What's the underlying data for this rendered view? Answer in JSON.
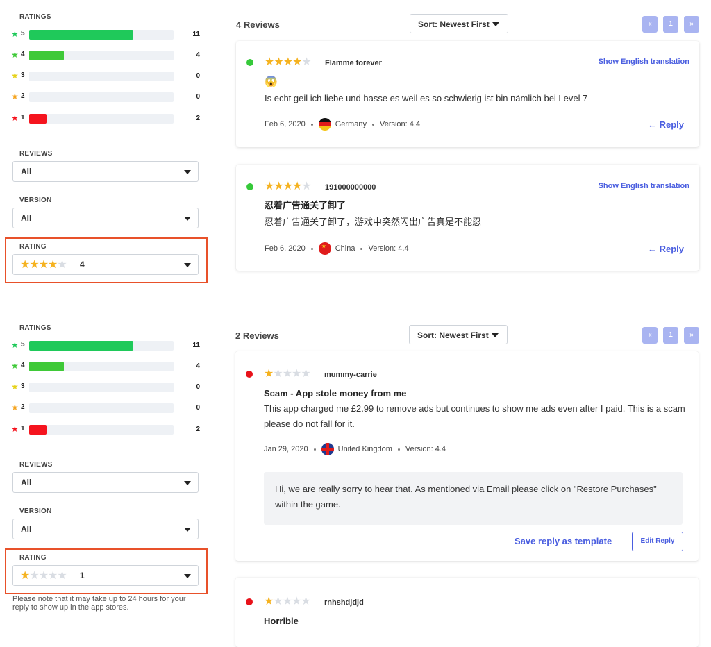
{
  "colors": {
    "accent": "#4a5ee0",
    "star_gold": "#f5b21f",
    "bar_green": "#1fc95a",
    "bar_lightgreen": "#3fc938",
    "bar_red": "#f5141e",
    "highlight": "#e8512a",
    "dot_green": "#36c93a",
    "dot_red": "#e8121a"
  },
  "panels": [
    {
      "sidebar": {
        "ratings_title": "RATINGS",
        "ratings": [
          {
            "stars": "5",
            "count": "11",
            "fraction": 0.72
          },
          {
            "stars": "4",
            "count": "4",
            "fraction": 0.24
          },
          {
            "stars": "3",
            "count": "0",
            "fraction": 0
          },
          {
            "stars": "2",
            "count": "0",
            "fraction": 0
          },
          {
            "stars": "1",
            "count": "2",
            "fraction": 0.12
          }
        ],
        "reviews_title": "REVIEWS",
        "reviews_value": "All",
        "version_title": "VERSION",
        "version_value": "All",
        "rating_title": "RATING",
        "rating_stars": "★★★★",
        "rating_stars_empty": "★",
        "rating_value": "4"
      },
      "header": {
        "count": "4 Reviews",
        "sort_label": "Sort: Newest First",
        "pagination": [
          "«",
          "1",
          "»"
        ]
      },
      "reviews": [
        {
          "stars": "★★★★",
          "stars_empty": "★",
          "author": "Flamme forever",
          "translate": "Show English translation",
          "title": "😱",
          "body": "Is echt geil ich liebe und hasse es weil es so schwierig ist bin nämlich bei Level 7",
          "date": "Feb 6, 2020",
          "country": "Germany",
          "version": "Version: 4.4",
          "reply": "← Reply"
        },
        {
          "stars": "★★★★",
          "stars_empty": "★",
          "author": "191000000000",
          "translate": "Show English translation",
          "title": "忍着广告通关了卸了",
          "body": "忍着广告通关了卸了，游戏中突然闪出广告真是不能忍",
          "date": "Feb 6, 2020",
          "country": "China",
          "version": "Version: 4.4",
          "reply": "← Reply"
        }
      ]
    },
    {
      "sidebar": {
        "ratings_title": "RATINGS",
        "ratings": [
          {
            "stars": "5",
            "count": "11",
            "fraction": 0.72
          },
          {
            "stars": "4",
            "count": "4",
            "fraction": 0.24
          },
          {
            "stars": "3",
            "count": "0",
            "fraction": 0
          },
          {
            "stars": "2",
            "count": "0",
            "fraction": 0
          },
          {
            "stars": "1",
            "count": "2",
            "fraction": 0.12
          }
        ],
        "reviews_title": "REVIEWS",
        "reviews_value": "All",
        "version_title": "VERSION",
        "version_value": "All",
        "rating_title": "RATING",
        "rating_stars": "★",
        "rating_stars_empty": "★★★★",
        "rating_value": "1",
        "note": "Please note that it may take up to 24 hours for your reply to show up in the app stores."
      },
      "header": {
        "count": "2 Reviews",
        "sort_label": "Sort: Newest First",
        "pagination": [
          "«",
          "1",
          "»"
        ]
      },
      "reviews": [
        {
          "stars": "★",
          "stars_empty": "★★★★",
          "author": "mummy-carrie",
          "title": "Scam - App stole money from me",
          "body": "This app charged me £2.99 to remove ads but continues to show me ads even after I paid. This is a scam please do not fall for it.",
          "date": "Jan 29, 2020",
          "country": "United Kingdom",
          "version": "Version: 4.4",
          "developer_reply": "Hi, we are really sorry to hear that. As mentioned via Email please click on \"Restore Purchases\" within the game.",
          "save_template": "Save reply as template",
          "edit_reply": "Edit Reply"
        },
        {
          "stars": "★",
          "stars_empty": "★★★★",
          "author": "rnhshdjdjd",
          "title": "Horrible"
        }
      ]
    }
  ]
}
